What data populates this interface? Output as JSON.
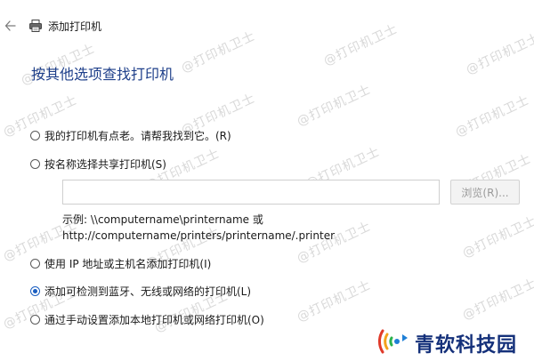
{
  "window": {
    "title": "添加打印机"
  },
  "heading": "按其他选项查找打印机",
  "options": [
    {
      "label": "我的打印机有点老。请帮我找到它。(R)",
      "checked": false
    },
    {
      "label": "按名称选择共享打印机(S)",
      "checked": false
    },
    {
      "label": "使用 IP 地址或主机名添加打印机(I)",
      "checked": false
    },
    {
      "label": "添加可检测到蓝牙、无线或网络的打印机(L)",
      "checked": true
    },
    {
      "label": "通过手动设置添加本地打印机或网络打印机(O)",
      "checked": false
    }
  ],
  "share": {
    "input_value": "",
    "browse_label": "浏览(R)...",
    "example_line1": "示例: \\\\computername\\printername 或",
    "example_line2": "http://computername/printers/printername/.printer"
  },
  "watermark": "@打印机卫士",
  "logo": {
    "text": "青软科技园"
  },
  "colors": {
    "heading": "#1e3f8a",
    "accent": "#1b5fc1",
    "watermark": "#d9d9d9"
  },
  "icons": {
    "back": "back-arrow-icon",
    "window": "printer-icon",
    "logo": "wifi-signal-icon"
  }
}
